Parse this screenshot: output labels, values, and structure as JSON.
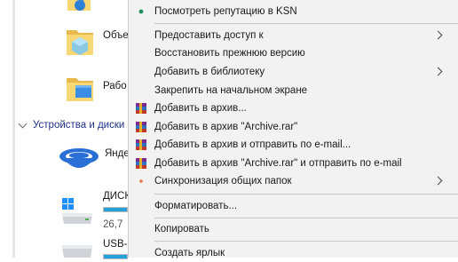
{
  "explorer": {
    "items": [
      {
        "label": "Объе",
        "icon": "music-folder-icon"
      },
      {
        "label": "Объе",
        "icon": "3d-objects-folder-icon"
      },
      {
        "label": "Рабо",
        "icon": "desktop-folder-icon"
      }
    ],
    "section_header": "Устройства и диски (",
    "cloud": {
      "label": "Янде",
      "icon": "yandex-disk-icon"
    },
    "drive_c": {
      "label": "ДИСК",
      "subtext": "26,7",
      "icon": "windows-drive-icon"
    },
    "drive_usb": {
      "label": "USB-",
      "icon": "usb-drive-icon"
    }
  },
  "context_menu": {
    "items": [
      {
        "label": "Посмотреть репутацию в KSN",
        "icon": "ksn-icon",
        "submenu": false
      },
      {
        "label": "Предоставить доступ к",
        "icon": "",
        "submenu": true
      },
      {
        "label": "Восстановить прежнюю версию",
        "icon": "",
        "submenu": false
      },
      {
        "label": "Добавить в библиотеку",
        "icon": "",
        "submenu": true
      },
      {
        "label": "Закрепить на начальном экране",
        "icon": "",
        "submenu": false
      },
      {
        "label": "Добавить в архив...",
        "icon": "winrar-icon",
        "submenu": false
      },
      {
        "label": "Добавить в архив \"Archive.rar\"",
        "icon": "winrar-icon",
        "submenu": false
      },
      {
        "label": "Добавить в архив и отправить по e-mail...",
        "icon": "winrar-icon",
        "submenu": false
      },
      {
        "label": "Добавить в архив \"Archive.rar\" и отправить по e-mail",
        "icon": "winrar-icon",
        "submenu": false
      },
      {
        "label": "Синхронизация общих папок",
        "icon": "sync-icon",
        "submenu": true
      },
      {
        "label": "Форматировать...",
        "icon": "",
        "submenu": false
      },
      {
        "label": "Копировать",
        "icon": "",
        "submenu": false
      },
      {
        "label": "Создать ярлык",
        "icon": "",
        "submenu": false
      }
    ]
  },
  "colors": {
    "menu_bg": "#f2f2f2",
    "accent_blue": "#26a0da",
    "section_header": "#1e3287",
    "folder_yellow": "#f8d775"
  }
}
